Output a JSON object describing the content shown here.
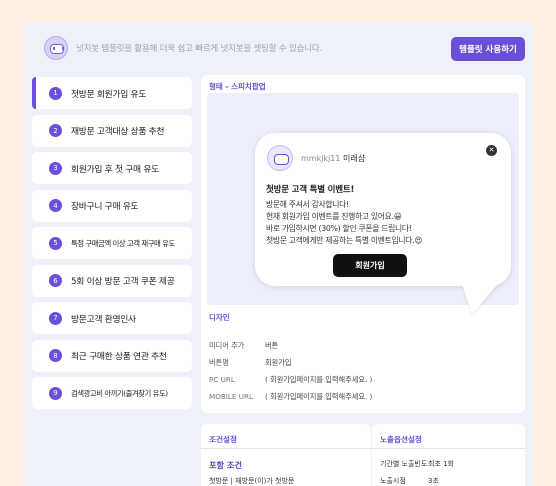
{
  "banner": {
    "text": "넛지봇 템플릿을 활용해 더욱 쉽고 빠르게 넛지봇을 셋팅할 수 있습니다.",
    "button": "템플릿 사용하기"
  },
  "steps": [
    {
      "num": "1",
      "label": "첫방문 회원가입 유도"
    },
    {
      "num": "2",
      "label": "재방문 고객대상 상품 추천"
    },
    {
      "num": "3",
      "label": "회원가입 후 첫 구매 유도"
    },
    {
      "num": "4",
      "label": "장바구니 구매 유도"
    },
    {
      "num": "5",
      "label": "특정 구매금액 이상 고객 재구매 유도"
    },
    {
      "num": "6",
      "label": "5회 이상 방문 고객 쿠폰 제공"
    },
    {
      "num": "7",
      "label": "방문고객 환영인사"
    },
    {
      "num": "8",
      "label": "최근 구매한 상품 연관 추천"
    },
    {
      "num": "9",
      "label": "검색광고비 아끼기(즐겨찾기 유도)"
    }
  ],
  "main": {
    "type_label": "형태 - 스피치팝업",
    "popup": {
      "name": "mmkjkj11",
      "brand": "미래샵",
      "close": "✕",
      "title": "첫방문 고객 특별 이벤트!",
      "lines": [
        "방문해 주셔서 감사합니다!",
        "현재 회원가입 이벤트를 진행하고 있어요.😀",
        "바로 가입하시면 (30%) 할인 쿠폰을 드립니다!",
        "첫방문 고객에게만 제공하는 특별 이벤트입니다.😍"
      ],
      "button": "회원가입"
    },
    "design_label": "디자인",
    "design_rows": [
      {
        "key": "미디어 추가",
        "value": "버튼"
      },
      {
        "key": "버튼명",
        "value": "회원가입"
      },
      {
        "key": "PC URL",
        "value": "( 회원가입페이지를 입력해주세요. )"
      },
      {
        "key": "MOBILE URL",
        "value": "( 회원가입페이지를 입력해주세요. )"
      }
    ]
  },
  "condition": {
    "title": "조건설정",
    "head": "포함 조건",
    "text": "첫방문 | 재방문(이)가 첫방문"
  },
  "exposure": {
    "title": "노출옵션설정",
    "rows": [
      {
        "key": "기간별 노출빈도",
        "value": "최초 1회"
      },
      {
        "key": "노출시점",
        "value": "3초"
      }
    ]
  }
}
